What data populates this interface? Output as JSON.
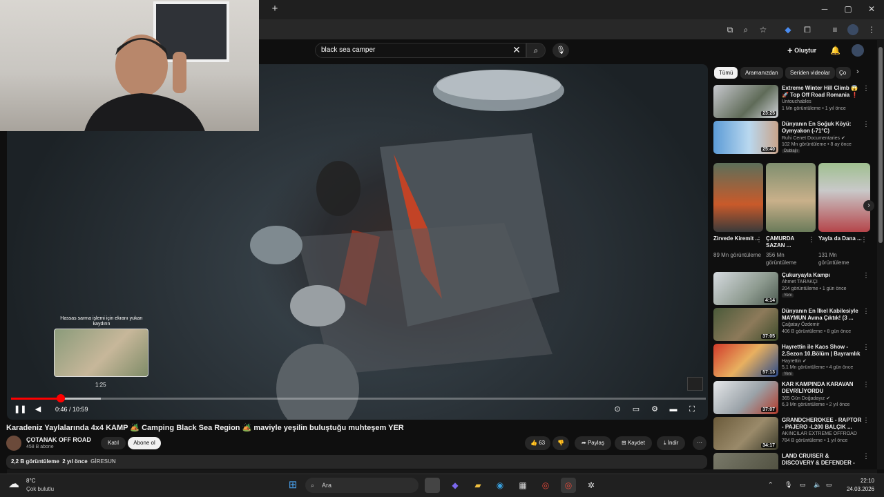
{
  "browser": {
    "new_tab": "+",
    "minimize": "─",
    "maximize": "▢",
    "close": "✕"
  },
  "header": {
    "search_value": "black sea camper",
    "clear": "✕",
    "search_icon": "⌕",
    "mic_icon": "🎙",
    "create_label": "Oluştur"
  },
  "player": {
    "scrub_hint": "Hassas sarma işlemi için ekranı yukarı kaydırın",
    "scrub_time": "1:25",
    "time": "0:46 / 10:59",
    "progress_played": 0.07,
    "progress_buffered": 0.13
  },
  "video": {
    "title": "Karadeniz Yaylalarında 4x4 KAMP 🏕️ Camping Black Sea Region 🏕️ maviyle yeşilin buluştuğu muhteşem YER",
    "channel": "ÇOTANAK OFF ROAD",
    "subs": "458 B abone",
    "join": "Katıl",
    "subscribe": "Abone ol",
    "likes": "63",
    "share": "Paylaş",
    "save": "Kaydet",
    "download": "İndir",
    "views": "2,2 B görüntüleme",
    "age": "2 yıl önce",
    "location": "GİRESUN"
  },
  "chips": [
    "Tümü",
    "Aramanızdan",
    "Seriden videolar",
    "Ço"
  ],
  "sidebar": [
    {
      "title": "Extreme Winter Hill Climb 😱🚀 Top Off Road Romania ❗",
      "channel": "Untouchables",
      "meta": "1 Mn görüntüleme • 1 yıl önce",
      "dur": "23:25",
      "badge": ""
    },
    {
      "title": "Dünyanın En Soğuk Köyü: Oymyakon (-71°C)",
      "channel": "Ruhi Cenet Documentaries ✔",
      "meta": "102 Mn görüntüleme • 8 ay önce",
      "dur": "25:40",
      "badge": "Dublajlı"
    },
    {
      "title": "Çukuryayla Kampı",
      "channel": "Ahmet TARAKÇI",
      "meta": "204 görüntüleme • 1 gün önce",
      "dur": "4:14",
      "badge": "Yeni"
    },
    {
      "title": "Dünyanın En İlkel Kabilesiyle MAYMUN Avına Çıktık! (3 ...",
      "channel": "Çağatay Özdemir",
      "meta": "406 B görüntüleme • 8 gün önce",
      "dur": "37:05",
      "badge": ""
    },
    {
      "title": "Hayrettin ile Kaos Show - 2.Sezon 10.Bölüm | Bayramlık ...",
      "channel": "Hayrettin ✔",
      "meta": "5,1 Mn görüntüleme • 4 gün önce",
      "dur": "57:13",
      "badge": "Yeni"
    },
    {
      "title": "KAR KAMPINDA KARAVAN DEVRİLİYORDU",
      "channel": "365 Gün Doğadayız ✔",
      "meta": "6,3 Mn görüntüleme • 2 yıl önce",
      "dur": "37:07",
      "badge": ""
    },
    {
      "title": "GRANDCHEROKEE - RAPTOR - PAJERO -L200 BALÇIK ...",
      "channel": "AKINCILAR EXTREME OFFROAD",
      "meta": "784 B görüntüleme • 1 yıl önce",
      "dur": "34:17",
      "badge": ""
    },
    {
      "title": "LAND CRUISER & DISCOVERY & DEFENDER - Extreme OFF ROAD",
      "channel": "",
      "meta": "",
      "dur": "",
      "badge": ""
    }
  ],
  "shorts": [
    {
      "title": "Zirvede Kiremit ...",
      "meta": "89 Mn görüntüleme"
    },
    {
      "title": "ÇAMURDA SAZAN ...",
      "meta": "356 Mn görüntüleme"
    },
    {
      "title": "Yayla da Dana ...",
      "meta": "131 Mn görüntüleme"
    }
  ],
  "taskbar": {
    "temp": "8°C",
    "weather": "Çok bulutlu",
    "search": "Ara",
    "time": "22:10",
    "date": "24.03.2026"
  },
  "colors": {
    "accent": "#ff0000",
    "bg": "#0f0f0f"
  }
}
